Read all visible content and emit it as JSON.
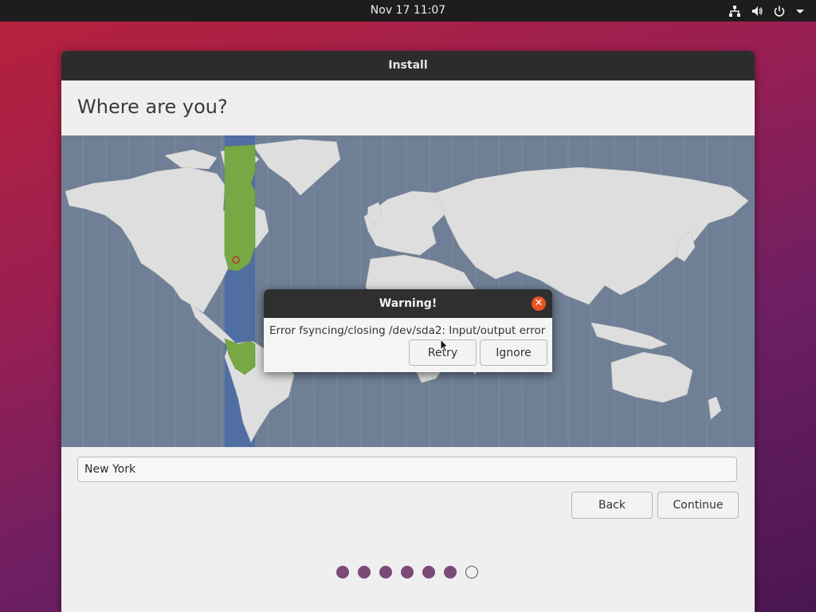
{
  "topbar": {
    "datetime": "Nov 17  11:07",
    "tray_icons": [
      "network-icon",
      "volume-icon",
      "power-icon",
      "chevron-down-icon"
    ]
  },
  "installer": {
    "window_title": "Install",
    "heading": "Where are you?",
    "city_value": "New York",
    "back_label": "Back",
    "continue_label": "Continue",
    "steps_total": 7,
    "steps_completed": 6
  },
  "dialog": {
    "title": "Warning!",
    "message": "Error fsyncing/closing /dev/sda2: Input/output error",
    "retry_label": "Retry",
    "ignore_label": "Ignore"
  },
  "colors": {
    "ocean": "#6f7f95",
    "land": "#dedede",
    "timezone_band": "#4f6ea2",
    "highlight_land": "#78a843",
    "close_button": "#e95420",
    "step_dot": "#7b4a77"
  }
}
